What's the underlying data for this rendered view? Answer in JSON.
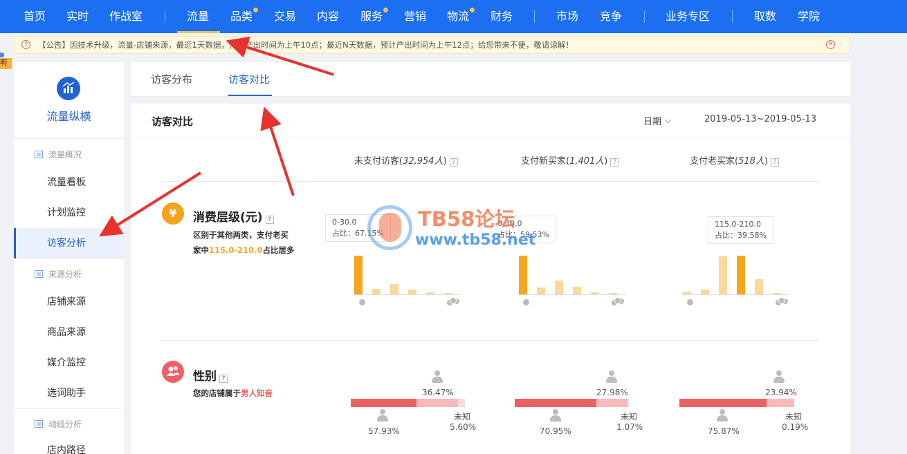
{
  "topnav": {
    "items": [
      "首页",
      "实时",
      "作战室",
      "流量",
      "品类",
      "交易",
      "内容",
      "服务",
      "营销",
      "物流",
      "财务",
      "市场",
      "竞争",
      "业务专区",
      "取数",
      "学院"
    ],
    "active": "流量",
    "accent": "#1b6ff0"
  },
  "notice": {
    "text": "【公告】因技术升级，流量-店铺来源，最近1天数据，预计产出时间为上午10点；最近N天数据，预计产出时间为上午12点；给您带来不便，敬请谅解！"
  },
  "edge_tag": "说明",
  "sidebar": {
    "brand": "流量纵横",
    "groups": {
      "overview": "流量概况",
      "source": "来源分析",
      "path": "动线分析"
    },
    "items": {
      "board": "流量看板",
      "monitor": "计划监控",
      "visitor": "访客分析",
      "shop_source": "店铺来源",
      "item_source": "商品来源",
      "media": "媒介监控",
      "keyword": "选词助手",
      "inshop_path": "店内路径"
    }
  },
  "tabs": {
    "distribution": "访客分布",
    "compare": "访客对比"
  },
  "card": {
    "title": "访客对比",
    "date_label": "日期",
    "date_range": "2019-05-13~2019-05-13"
  },
  "columns": [
    {
      "label": "未支付访客(",
      "count": "32,954人",
      "close": ")"
    },
    {
      "label": "支付新买家(",
      "count": "1,401人",
      "close": ")"
    },
    {
      "label": "支付老买家(",
      "count": "518人",
      "close": ")"
    }
  ],
  "spending": {
    "icon": "¥",
    "title": "消费层级(元)",
    "desc_a": "区别于其他两类，支付老买",
    "desc_b": "家中",
    "desc_hl": "115.0-210.0",
    "desc_c": "占比居多",
    "charts": [
      {
        "tip_range": "0-30.0",
        "tip_share": "占比：67.15%",
        "bars": [
          1.0,
          0.14,
          0.27,
          0.13,
          0.05,
          0.03
        ],
        "highlight": 0
      },
      {
        "tip_range": "0-30.0",
        "tip_share": "占比：59.53%",
        "bars": [
          1.0,
          0.17,
          0.35,
          0.2,
          0.05,
          0.03
        ],
        "highlight": 0
      },
      {
        "tip_range": "115.0-210.0",
        "tip_share": "占比：39.58%",
        "bars": [
          0.07,
          0.13,
          0.98,
          1.0,
          0.4,
          0.04
        ],
        "highlight": 3
      }
    ]
  },
  "gender": {
    "title": "性别",
    "desc": "您的店铺属于",
    "desc_hl": "男人知音",
    "unknown_label": "未知",
    "columns": [
      {
        "female": "36.47%",
        "male": "57.93%",
        "unknown": "5.60%",
        "male_v": 57.93,
        "female_v": 36.47,
        "unknown_v": 5.6
      },
      {
        "female": "27.98%",
        "male": "70.95%",
        "unknown": "1.07%",
        "male_v": 70.95,
        "female_v": 27.98,
        "unknown_v": 1.07
      },
      {
        "female": "23.94%",
        "male": "75.87%",
        "unknown": "0.19%",
        "male_v": 75.87,
        "female_v": 23.94,
        "unknown_v": 0.19
      }
    ],
    "colors": {
      "male": "#ec6264",
      "female": "#f7b9b9",
      "unknown": "#f3dcdc"
    }
  },
  "watermark": {
    "line1": "TB58论坛",
    "line2": "www.tb58.net"
  }
}
